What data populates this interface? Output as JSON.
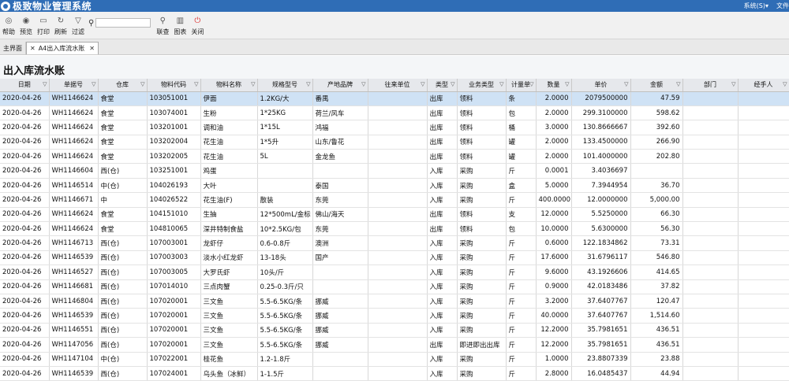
{
  "app": {
    "title": "极致物业管理系统",
    "menu_system": "系统(S)▾",
    "menu_file": "文件"
  },
  "toolbar": {
    "buttons": [
      {
        "icon": "help-icon",
        "label": "帮助"
      },
      {
        "icon": "preview-icon",
        "label": "预览"
      },
      {
        "icon": "print-icon",
        "label": "打印"
      },
      {
        "icon": "refresh-icon",
        "label": "刷新"
      },
      {
        "icon": "filter-icon",
        "label": "过滤"
      }
    ],
    "search_value": "",
    "right_buttons": [
      {
        "icon": "search-icon",
        "label": "联查"
      },
      {
        "icon": "chart-icon",
        "label": "图表"
      },
      {
        "icon": "power-icon",
        "label": "关闭"
      }
    ]
  },
  "tabs": [
    {
      "label": "主界面"
    },
    {
      "label": "A4出入库流水账"
    }
  ],
  "page_title": "出入库流水账",
  "columns": [
    "日期",
    "单据号",
    "仓库",
    "物料代码",
    "物料名称",
    "规格型号",
    "产地品牌",
    "往来单位",
    "类型",
    "业务类型",
    "计量单",
    "数量",
    "单价",
    "金额",
    "部门",
    "经手人"
  ],
  "rows": [
    [
      "2020-04-26",
      "WH1146624",
      "食堂",
      "103051001",
      "伊面",
      "1.2KG/大",
      "番禺",
      "",
      "出库",
      "领料",
      "条",
      "2.0000",
      "2079500000",
      "47.59",
      "",
      ""
    ],
    [
      "2020-04-26",
      "WH1146624",
      "食堂",
      "103074001",
      "生粉",
      "1*25KG",
      "荷兰/风车",
      "",
      "出库",
      "领料",
      "包",
      "2.0000",
      "299.3100000",
      "598.62",
      "",
      ""
    ],
    [
      "2020-04-26",
      "WH1146624",
      "食堂",
      "103201001",
      "调和油",
      "1*15L",
      "鸿福",
      "",
      "出库",
      "领料",
      "桶",
      "3.0000",
      "130.8666667",
      "392.60",
      "",
      ""
    ],
    [
      "2020-04-26",
      "WH1146624",
      "食堂",
      "103202004",
      "花生油",
      "1*5升",
      "山东/鲁花",
      "",
      "出库",
      "领料",
      "罐",
      "2.0000",
      "133.4500000",
      "266.90",
      "",
      ""
    ],
    [
      "2020-04-26",
      "WH1146624",
      "食堂",
      "103202005",
      "花生油",
      "5L",
      "金龙鱼",
      "",
      "出库",
      "领料",
      "罐",
      "2.0000",
      "101.4000000",
      "202.80",
      "",
      ""
    ],
    [
      "2020-04-26",
      "WH1146604",
      "西(仓)",
      "103251001",
      "鸡蛋",
      "",
      "",
      "",
      "入库",
      "采购",
      "斤",
      "0.0001",
      "3.4036697",
      "",
      "",
      ""
    ],
    [
      "2020-04-26",
      "WH1146514",
      "中(仓)",
      "104026193",
      "大叶",
      "",
      "泰国",
      "",
      "入库",
      "采购",
      "盒",
      "5.0000",
      "7.3944954",
      "36.70",
      "",
      ""
    ],
    [
      "2020-04-26",
      "WH1146671",
      "中",
      "104026522",
      "花生油(F)",
      "散装",
      "东莞",
      "",
      "入库",
      "采购",
      "斤",
      "400.0000",
      "12.0000000",
      "5,000.00",
      "",
      ""
    ],
    [
      "2020-04-26",
      "WH1146624",
      "食堂",
      "104151010",
      "生抽",
      "12*500mL/金标",
      "佛山/海天",
      "",
      "出库",
      "领料",
      "支",
      "12.0000",
      "5.5250000",
      "66.30",
      "",
      ""
    ],
    [
      "2020-04-26",
      "WH1146624",
      "食堂",
      "104810065",
      "深井特制食盐",
      "10*2.5KG/包",
      "东莞",
      "",
      "出库",
      "领料",
      "包",
      "10.0000",
      "5.6300000",
      "56.30",
      "",
      ""
    ],
    [
      "2020-04-26",
      "WH1146713",
      "西(仓)",
      "107003001",
      "龙虾仔",
      "0.6-0.8斤",
      "澳洲",
      "",
      "入库",
      "采购",
      "斤",
      "0.6000",
      "122.1834862",
      "73.31",
      "",
      ""
    ],
    [
      "2020-04-26",
      "WH1146539",
      "西(仓)",
      "107003003",
      "淡水小红龙虾",
      "13-18头",
      "国产",
      "",
      "入库",
      "采购",
      "斤",
      "17.6000",
      "31.6796117",
      "546.80",
      "",
      ""
    ],
    [
      "2020-04-26",
      "WH1146527",
      "西(仓)",
      "107003005",
      "大罗氏虾",
      "10头/斤",
      "",
      "",
      "入库",
      "采购",
      "斤",
      "9.6000",
      "43.1926606",
      "414.65",
      "",
      ""
    ],
    [
      "2020-04-26",
      "WH1146681",
      "西(仓)",
      "107014010",
      "三点肉蟹",
      "0.25-0.3斤/只",
      "",
      "",
      "入库",
      "采购",
      "斤",
      "0.9000",
      "42.0183486",
      "37.82",
      "",
      ""
    ],
    [
      "2020-04-26",
      "WH1146804",
      "西(仓)",
      "107020001",
      "三文鱼",
      "5.5-6.5KG/条",
      "挪威",
      "",
      "入库",
      "采购",
      "斤",
      "3.2000",
      "37.6407767",
      "120.47",
      "",
      ""
    ],
    [
      "2020-04-26",
      "WH1146539",
      "西(仓)",
      "107020001",
      "三文鱼",
      "5.5-6.5KG/条",
      "挪威",
      "",
      "入库",
      "采购",
      "斤",
      "40.0000",
      "37.6407767",
      "1,514.60",
      "",
      ""
    ],
    [
      "2020-04-26",
      "WH1146551",
      "西(仓)",
      "107020001",
      "三文鱼",
      "5.5-6.5KG/条",
      "挪威",
      "",
      "入库",
      "采购",
      "斤",
      "12.2000",
      "35.7981651",
      "436.51",
      "",
      ""
    ],
    [
      "2020-04-26",
      "WH1147056",
      "西(仓)",
      "107020001",
      "三文鱼",
      "5.5-6.5KG/条",
      "挪威",
      "",
      "出库",
      "即进即出出库",
      "斤",
      "12.2000",
      "35.7981651",
      "436.51",
      "",
      ""
    ],
    [
      "2020-04-26",
      "WH1147104",
      "中(仓)",
      "107022001",
      "桂花鱼",
      "1.2-1.8斤",
      "",
      "",
      "入库",
      "采购",
      "斤",
      "1.0000",
      "23.8807339",
      "23.88",
      "",
      ""
    ],
    [
      "2020-04-26",
      "WH1146539",
      "西(仓)",
      "107024001",
      "乌头鱼（冰鲜）",
      "1-1.5斤",
      "",
      "",
      "入库",
      "采购",
      "斤",
      "2.8000",
      "16.0485437",
      "44.94",
      "",
      ""
    ]
  ]
}
